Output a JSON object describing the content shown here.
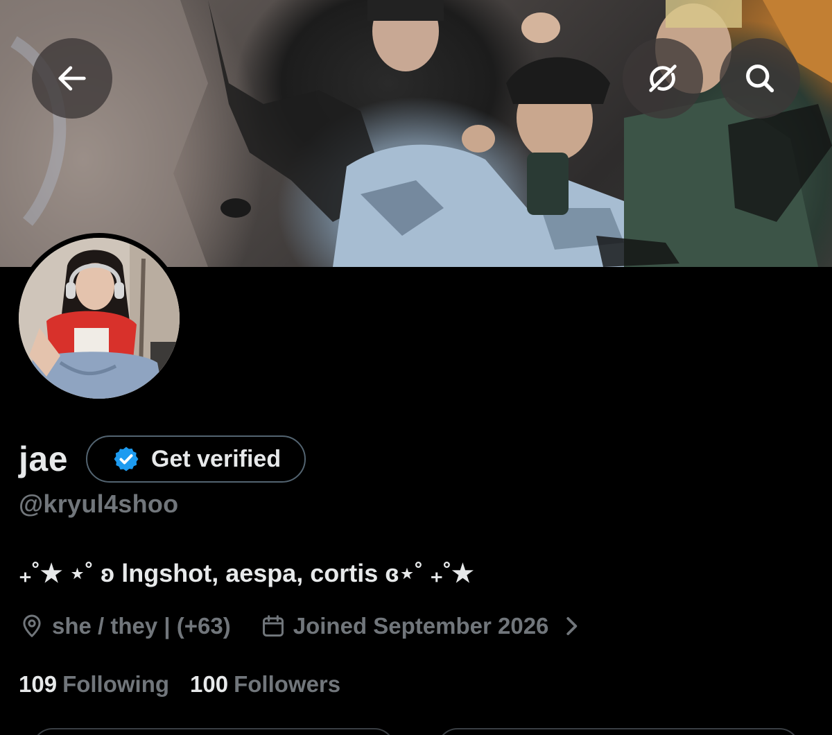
{
  "header": {
    "back_icon": "arrow-left-icon",
    "grok_icon": "grok-icon",
    "search_icon": "search-icon",
    "button_bg": "#3c3737"
  },
  "profile": {
    "display_name": "jae",
    "verify_label": "Get verified",
    "handle": "@kryul4shoo",
    "bio": "₊˚★ ⋆˚ ʚ lngshot, aespa, cortis ɞ⋆˚ ₊˚★",
    "location": "she / they | (+63)",
    "joined": "Joined September 2026",
    "following_count": "109",
    "following_label": "Following",
    "followers_count": "100",
    "followers_label": "Followers"
  },
  "colors": {
    "background": "#000000",
    "text_primary": "#e7e9ea",
    "text_secondary": "#71767b",
    "verified_blue": "#1d9bf0",
    "border": "#536471"
  }
}
